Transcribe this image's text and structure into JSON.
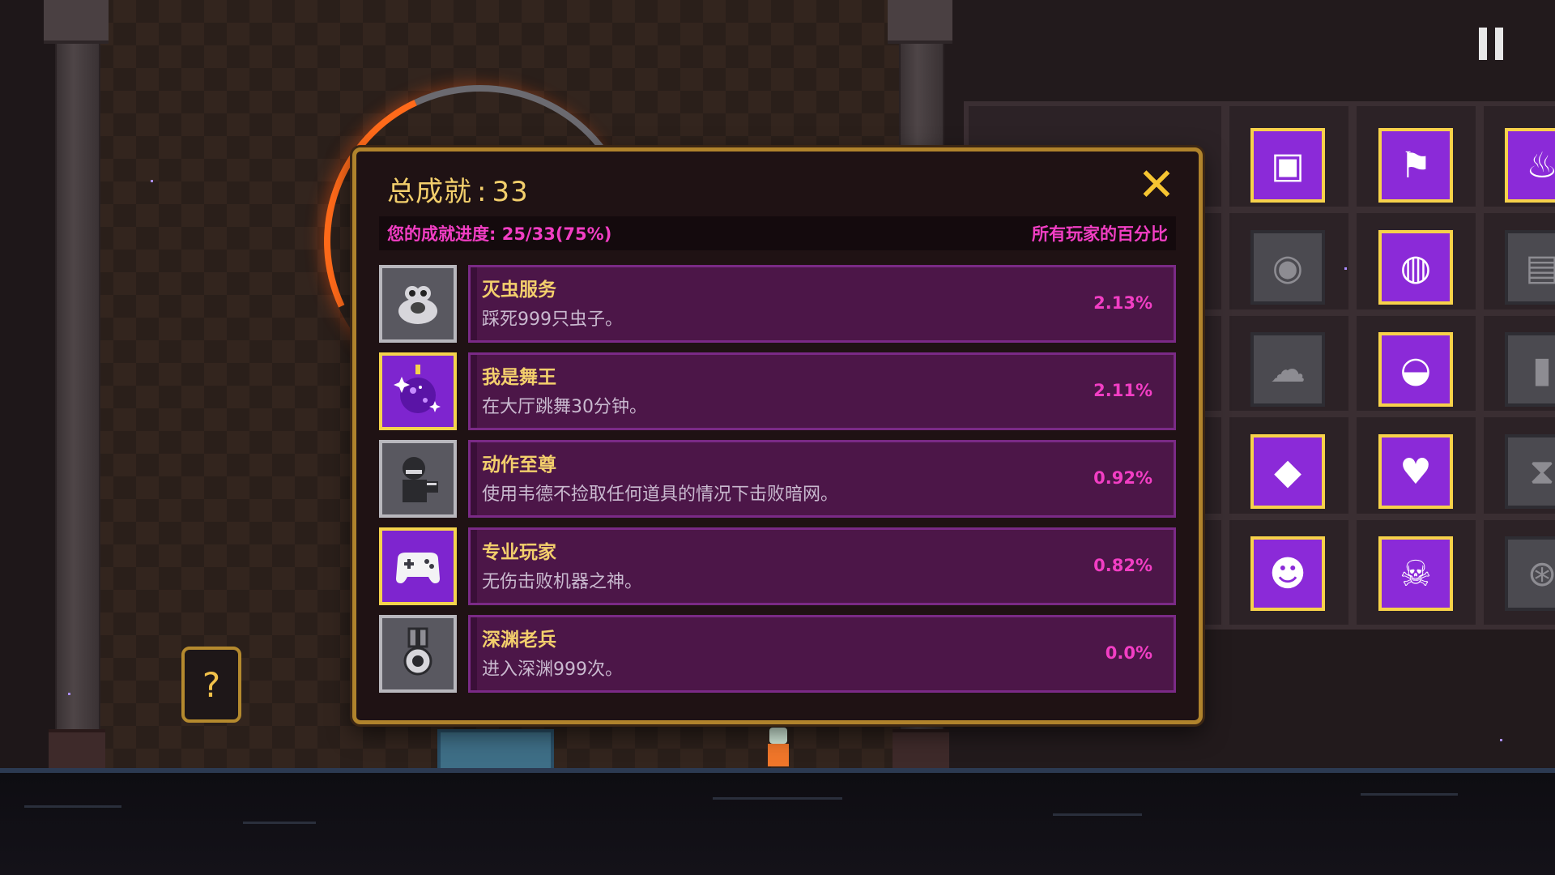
{
  "panel": {
    "title_label": "总成就",
    "title_separator": ":",
    "total_achievements": "33",
    "progress_text": "您的成就进度: 25/33(75%)",
    "global_percent_label": "所有玩家的百分比"
  },
  "achievements": [
    {
      "name": "灭虫服务",
      "description": "踩死999只虫子。",
      "percent": "2.13%",
      "unlocked": false,
      "icon": "worm-icon"
    },
    {
      "name": "我是舞王",
      "description": "在大厅跳舞30分钟。",
      "percent": "2.11%",
      "unlocked": true,
      "icon": "disco-ball-icon"
    },
    {
      "name": "动作至尊",
      "description": "使用韦德不捡取任何道具的情况下击败暗网。",
      "percent": "0.92%",
      "unlocked": false,
      "icon": "fighter-icon"
    },
    {
      "name": "专业玩家",
      "description": "无伤击败机器之神。",
      "percent": "0.82%",
      "unlocked": true,
      "icon": "gamepad-icon"
    },
    {
      "name": "深渊老兵",
      "description": "进入深渊999次。",
      "percent": "0.0%",
      "unlocked": false,
      "icon": "medal-icon"
    }
  ],
  "help_button": {
    "icon": "question-icon",
    "glyph": "?"
  },
  "close_button": {
    "icon": "close-icon",
    "glyph": "✕"
  },
  "colors": {
    "accent_magenta": "#f23ec4",
    "gold": "#f3cf6c",
    "unlocked_bg": "#7e25cf",
    "locked_bg": "#595860",
    "row_bg": "#4c1648"
  }
}
